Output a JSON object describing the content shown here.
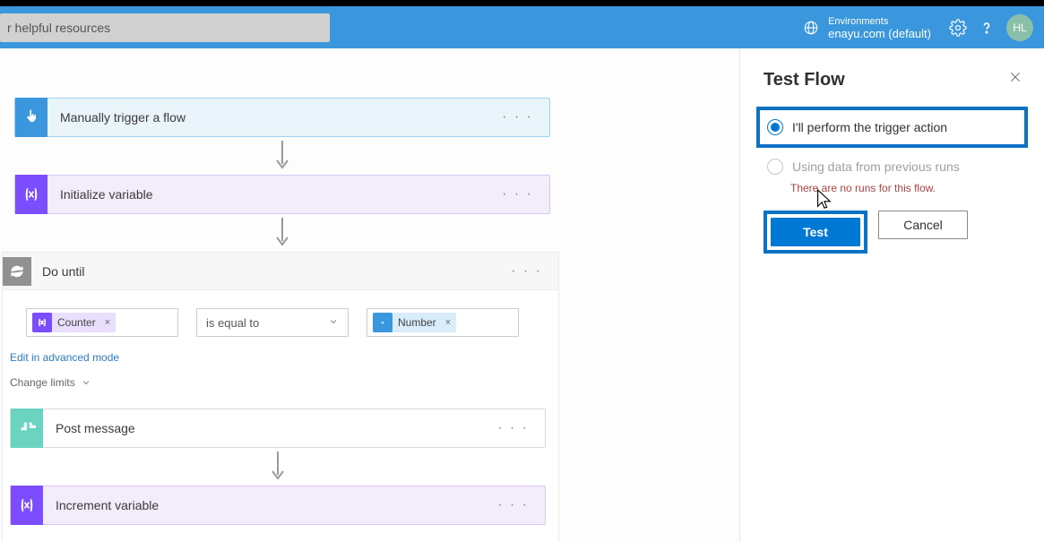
{
  "header": {
    "search_placeholder": "Search for helpful resources",
    "search_value": "r helpful resources",
    "env_label": "Environments",
    "env_name": "enayu.com (default)",
    "avatar_initials": "HL"
  },
  "flow": {
    "trigger": {
      "title": "Manually trigger a flow"
    },
    "init_var": {
      "title": "Initialize variable"
    },
    "do_until": {
      "title": "Do until",
      "left_token": "Counter",
      "operator": "is equal to",
      "right_token": "Number",
      "advanced_link": "Edit in advanced mode",
      "limits_link": "Change limits"
    },
    "post_msg": {
      "title": "Post message"
    },
    "incr_var": {
      "title": "Increment variable"
    }
  },
  "panel": {
    "title": "Test Flow",
    "opt_manual": "I'll perform the trigger action",
    "opt_previous": "Using data from previous runs",
    "no_runs_msg": "There are no runs for this flow.",
    "btn_test": "Test",
    "btn_cancel": "Cancel"
  }
}
